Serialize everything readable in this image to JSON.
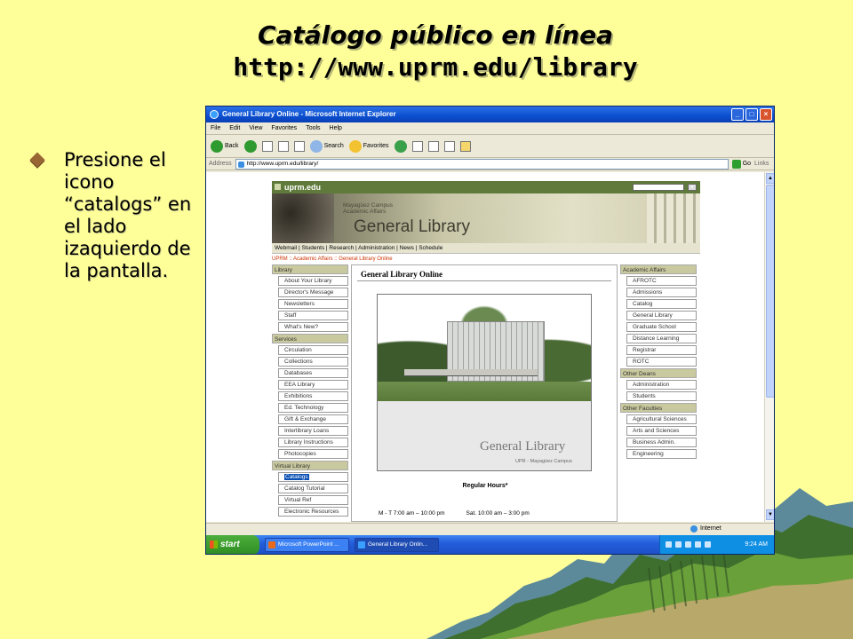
{
  "slide": {
    "title_line1": "Catálogo  público en línea",
    "title_line2": "http://www.uprm.edu/library",
    "bullet_text": "Presione el icono “catalogs” en el lado izaquierdo de la pantalla."
  },
  "browser": {
    "window_title": "General Library Online - Microsoft Internet Explorer",
    "menu": [
      "File",
      "Edit",
      "View",
      "Favorites",
      "Tools",
      "Help"
    ],
    "toolbar": {
      "back": "Back",
      "search": "Search",
      "favorites": "Favorites"
    },
    "address_label": "Address",
    "address_value": "http://www.uprm.edu/library/",
    "go_label": "Go",
    "links_label": "Links",
    "status_zone": "Internet"
  },
  "taskbar": {
    "start_label": "start",
    "tasks": [
      "Microsoft PowerPoint ...",
      "General Library Onlin..."
    ],
    "clock": "9:24 AM"
  },
  "site": {
    "brand": "uprm.edu",
    "campus_line1": "Mayagüez Campus",
    "campus_line2": "Academic Affairs",
    "banner_title": "General Library",
    "nav": "Webmail | Students | Research | Administration | News | Schedule",
    "breadcrumb": "UPRM :: Academic Affairs :: General Library Online",
    "left_sections": [
      {
        "header": "Library",
        "items": [
          "About Your Library",
          "Director's Message",
          "Newsletters",
          "Staff",
          "What's New?"
        ]
      },
      {
        "header": "Services",
        "items": [
          "Circulation",
          "Collections",
          "Databases",
          "EEA Library",
          "Exhibitions",
          "Ed. Technology",
          "Gift & Exchange",
          "Interlibrary Loans",
          "Library Instructions",
          "Photocopies"
        ]
      },
      {
        "header": "Virtual Library",
        "items": [
          "Catalogs",
          "Catalog Tutorial",
          "Virtual Ref",
          "Electronic Resources"
        ]
      }
    ],
    "center_title": "General Library Online",
    "photo_caption_title": "General Library",
    "photo_caption_sub": "UPR - Mayagüez Campus",
    "hours_title": "Regular Hours*",
    "hours_weekday": "M - T 7:00 am – 10:00 pm",
    "hours_saturday": "Sat. 10:00 am – 3:00 pm",
    "right_sections": [
      {
        "header": "Academic Affairs",
        "items": [
          "AFROTC",
          "Admissions",
          "Catalog",
          "General Library",
          "Graduate School",
          "Distance Learning",
          "Registrar",
          "ROTC"
        ]
      },
      {
        "header": "Other Deans",
        "items": [
          "Administration",
          "Students"
        ]
      },
      {
        "header": "Other Faculties",
        "items": [
          "Agricultural Sciences",
          "Arts and Sciences",
          "Business Admin.",
          "Engineering"
        ]
      }
    ]
  }
}
